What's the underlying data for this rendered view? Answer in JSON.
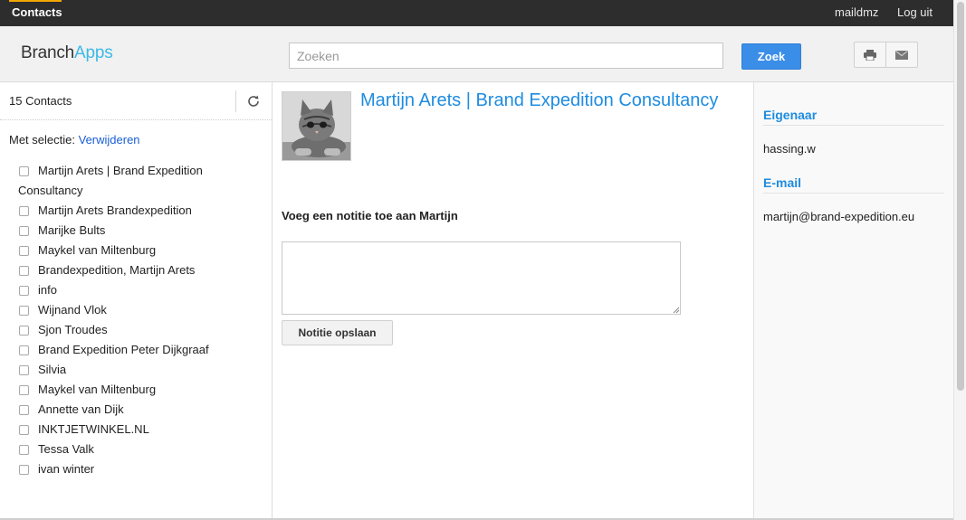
{
  "topbar": {
    "app_name": "Contacts",
    "user": "maildmz",
    "logout": "Log uit"
  },
  "header": {
    "logo_main": "Branch",
    "logo_accent": "Apps",
    "search_placeholder": "Zoeken",
    "search_button": "Zoek",
    "icons": [
      "print-icon",
      "mail-icon"
    ]
  },
  "sidebar": {
    "count": "15 Contacts",
    "selection_label": "Met selectie:",
    "selection_action": "Verwijderen",
    "contacts": [
      {
        "name_line1": "Martijn Arets | Brand Expedition",
        "name_line2": "Consultancy"
      },
      {
        "name_line1": "Martijn Arets Brandexpedition"
      },
      {
        "name_line1": "Marijke Bults"
      },
      {
        "name_line1": "Maykel van Miltenburg"
      },
      {
        "name_line1": "Brandexpedition, Martijn Arets"
      },
      {
        "name_line1": "info"
      },
      {
        "name_line1": "Wijnand Vlok"
      },
      {
        "name_line1": "Sjon Troudes"
      },
      {
        "name_line1": "Brand Expedition Peter Dijkgraaf"
      },
      {
        "name_line1": "Silvia"
      },
      {
        "name_line1": "Maykel van Miltenburg"
      },
      {
        "name_line1": "Annette van Dijk"
      },
      {
        "name_line1": "INKTJETWINKEL.NL"
      },
      {
        "name_line1": "Tessa Valk"
      },
      {
        "name_line1": "ivan winter"
      }
    ]
  },
  "main": {
    "contact_title": "Martijn Arets | Brand Expedition Consultancy",
    "note_label": "Voeg een notitie toe aan Martijn",
    "note_value": "",
    "save_button": "Notitie opslaan"
  },
  "details": {
    "owner_title": "Eigenaar",
    "owner_value": "hassing.w",
    "email_title": "E-mail",
    "email_value": "martijn@brand-expedition.eu"
  },
  "colors": {
    "accent_blue": "#1f8ce0",
    "logo_accent": "#3cb9e8",
    "button_blue": "#3b8ee8",
    "topbar": "#2d2d2d"
  }
}
